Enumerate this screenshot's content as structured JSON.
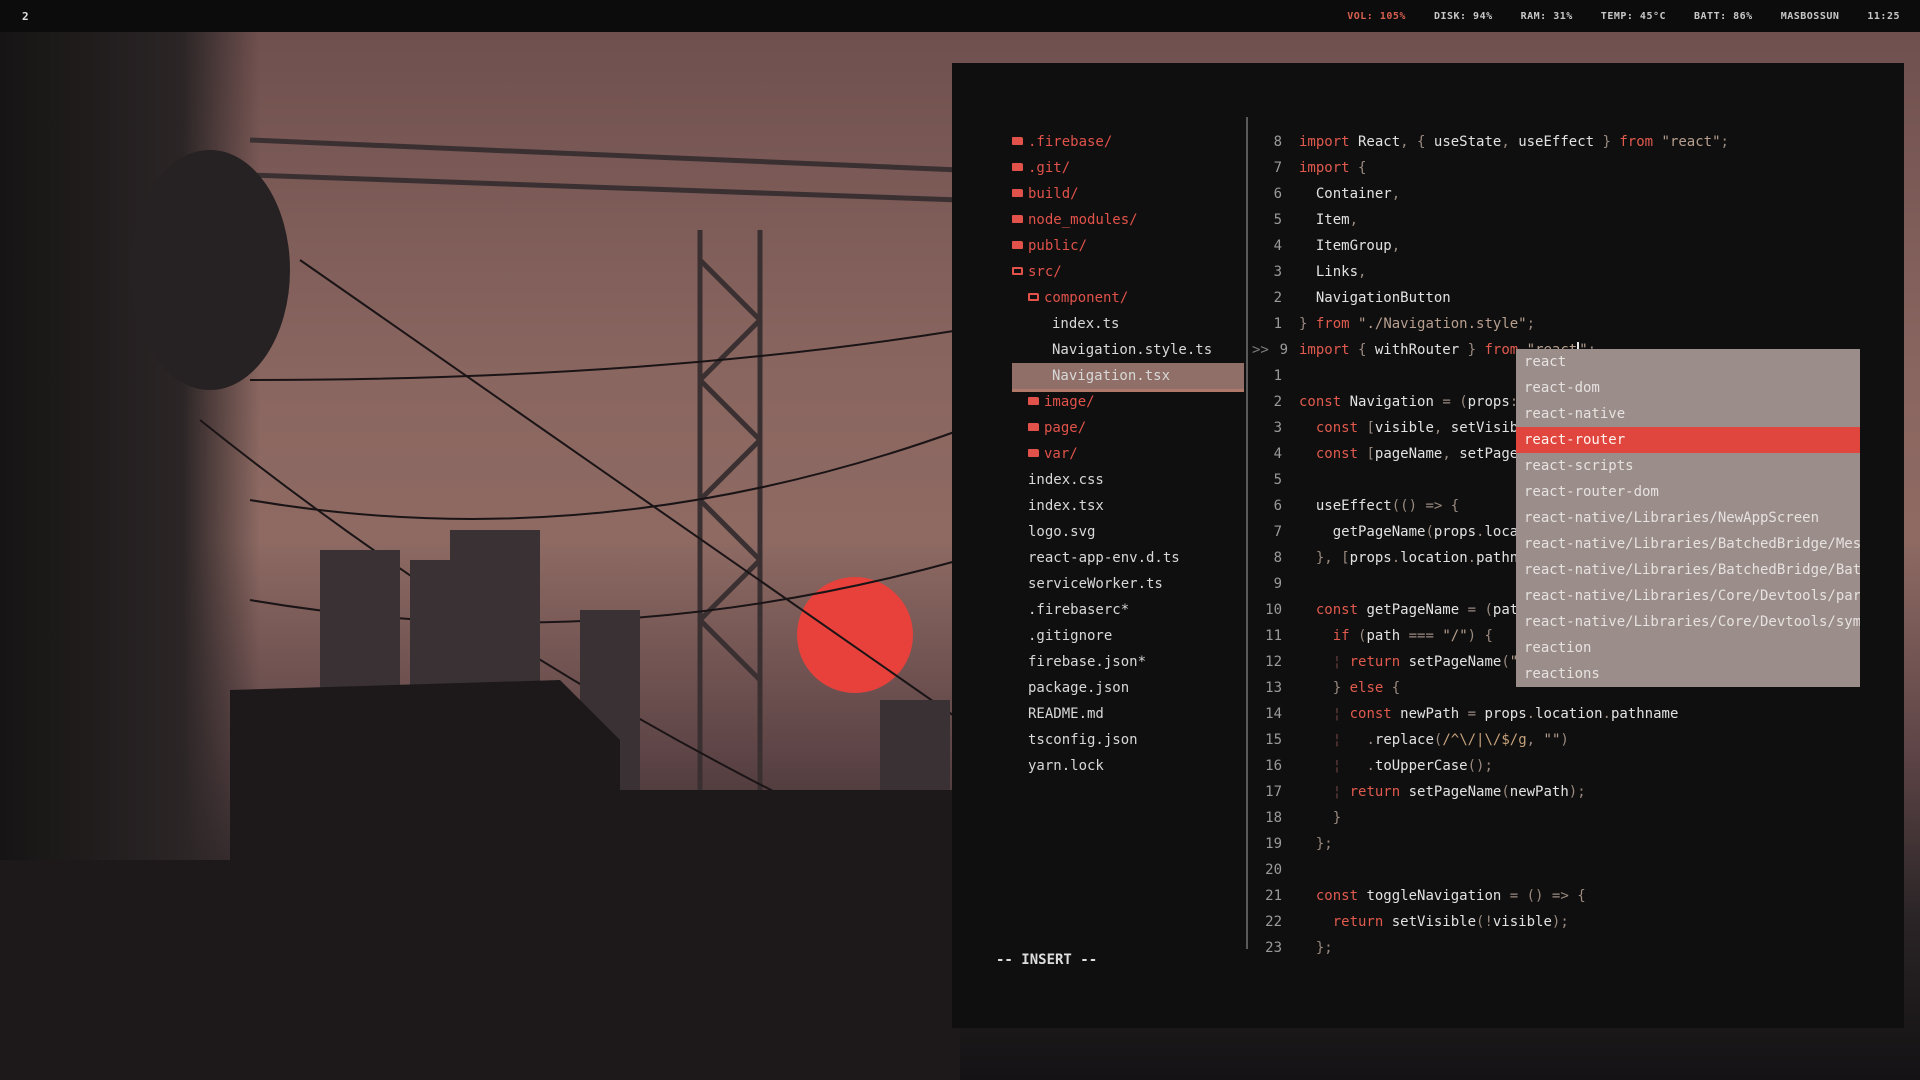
{
  "topbar": {
    "workspace": "2",
    "vol": "VOL: 105%",
    "disk": "DISK: 94%",
    "ram": "RAM: 31%",
    "temp": "TEMP: 45°C",
    "batt": "BATT: 86%",
    "host": "MASBOSSUN",
    "time": "11:25"
  },
  "tree": [
    {
      "label": ".firebase/",
      "type": "dir",
      "indent": 0
    },
    {
      "label": ".git/",
      "type": "dir",
      "indent": 0
    },
    {
      "label": "build/",
      "type": "dir",
      "indent": 0
    },
    {
      "label": "node_modules/",
      "type": "dir",
      "indent": 0
    },
    {
      "label": "public/",
      "type": "dir",
      "indent": 0
    },
    {
      "label": "src/",
      "type": "dir-open",
      "indent": 0
    },
    {
      "label": "component/",
      "type": "dir-open",
      "indent": 1
    },
    {
      "label": "index.ts",
      "type": "file",
      "indent": 2
    },
    {
      "label": "Navigation.style.ts",
      "type": "file",
      "indent": 2
    },
    {
      "label": "Navigation.tsx",
      "type": "file",
      "indent": 2,
      "selected": true
    },
    {
      "label": "image/",
      "type": "dir",
      "indent": 1
    },
    {
      "label": "page/",
      "type": "dir",
      "indent": 1
    },
    {
      "label": "var/",
      "type": "dir",
      "indent": 1
    },
    {
      "label": "index.css",
      "type": "file",
      "indent": 1
    },
    {
      "label": "index.tsx",
      "type": "file",
      "indent": 1
    },
    {
      "label": "logo.svg",
      "type": "file",
      "indent": 1
    },
    {
      "label": "react-app-env.d.ts",
      "type": "file",
      "indent": 1
    },
    {
      "label": "serviceWorker.ts",
      "type": "file",
      "indent": 1
    },
    {
      "label": ".firebaserc*",
      "type": "file",
      "indent": 0
    },
    {
      "label": ".gitignore",
      "type": "file",
      "indent": 0
    },
    {
      "label": "firebase.json*",
      "type": "file",
      "indent": 0
    },
    {
      "label": "package.json",
      "type": "file",
      "indent": 0
    },
    {
      "label": "README.md",
      "type": "file",
      "indent": 0
    },
    {
      "label": "tsconfig.json",
      "type": "file",
      "indent": 0
    },
    {
      "label": "yarn.lock",
      "type": "file",
      "indent": 0
    }
  ],
  "code": [
    {
      "n": "8",
      "html": "<span class=\"kw\">import</span> React<span class=\"punc\">,</span> <span class=\"punc\">{</span> useState<span class=\"punc\">,</span> useEffect <span class=\"punc\">}</span> <span class=\"kw\">from</span> <span class=\"str\">\"react\"</span><span class=\"punc\">;</span>"
    },
    {
      "n": "7",
      "html": "<span class=\"kw\">import</span> <span class=\"punc\">{</span>"
    },
    {
      "n": "6",
      "html": "  Container<span class=\"punc\">,</span>"
    },
    {
      "n": "5",
      "html": "  Item<span class=\"punc\">,</span>"
    },
    {
      "n": "4",
      "html": "  ItemGroup<span class=\"punc\">,</span>"
    },
    {
      "n": "3",
      "html": "  Links<span class=\"punc\">,</span>"
    },
    {
      "n": "2",
      "html": "  NavigationButton"
    },
    {
      "n": "1",
      "html": "<span class=\"punc\">}</span> <span class=\"kw\">from</span> <span class=\"str\">\"./Navigation.style\"</span><span class=\"punc\">;</span>"
    },
    {
      "n": "9",
      "current": true,
      "html": "<span class=\"kw\">import</span> <span class=\"punc\">{</span> withRouter <span class=\"punc\">}</span> <span class=\"kw\">from</span> <span class=\"str ul\">\"react</span><span id=\"cursor\"></span><span class=\"str ul\">\"</span><span class=\"punc\">;</span>"
    },
    {
      "n": "1",
      "html": ""
    },
    {
      "n": "2",
      "html": "<span class=\"kw\">const</span> Navigation <span class=\"punc\">=</span> <span class=\"punc\">(</span>props<span class=\"punc\">:</span>"
    },
    {
      "n": "3",
      "html": "  <span class=\"kw\">const</span> <span class=\"punc\">[</span>visible<span class=\"punc\">,</span> setVisibl"
    },
    {
      "n": "4",
      "html": "  <span class=\"kw\">const</span> <span class=\"punc\">[</span>pageName<span class=\"punc\">,</span> setPageN"
    },
    {
      "n": "5",
      "html": ""
    },
    {
      "n": "6",
      "html": "  useEffect<span class=\"punc\">(()</span> <span class=\"punc\">=&gt;</span> <span class=\"punc\">{</span>"
    },
    {
      "n": "7",
      "html": "    getPageName<span class=\"punc\">(</span>props<span class=\"punc\">.</span>locat"
    },
    {
      "n": "8",
      "html": "  <span class=\"punc\">},</span> <span class=\"punc\">[</span>props<span class=\"punc\">.</span>location<span class=\"punc\">.</span>pathna"
    },
    {
      "n": "9",
      "html": ""
    },
    {
      "n": "10",
      "html": "  <span class=\"kw\">const</span> getPageName <span class=\"punc\">=</span> <span class=\"punc\">(</span>path"
    },
    {
      "n": "11",
      "html": "    <span class=\"kw\">if</span> <span class=\"punc\">(</span>path <span class=\"punc\">===</span> <span class=\"str\">\"/\"</span><span class=\"punc\">)</span> <span class=\"punc\">{</span>"
    },
    {
      "n": "12",
      "html": "    <span class=\"bar\">¦</span> <span class=\"kw\">return</span> setPageName<span class=\"punc\">(</span><span class=\"str\">\"M</span>"
    },
    {
      "n": "13",
      "html": "    <span class=\"punc\">}</span> <span class=\"kw\">else</span> <span class=\"punc\">{</span>"
    },
    {
      "n": "14",
      "html": "    <span class=\"bar\">¦</span> <span class=\"kw\">const</span> newPath <span class=\"punc\">=</span> props<span class=\"punc\">.</span>location<span class=\"punc\">.</span>pathname"
    },
    {
      "n": "15",
      "html": "    <span class=\"bar\">¦</span>   <span class=\"punc\">.</span>replace<span class=\"punc\">(</span><span class=\"rx\">/^\\/|\\/$/g</span><span class=\"punc\">,</span> <span class=\"str\">\"\"</span><span class=\"punc\">)</span>"
    },
    {
      "n": "16",
      "html": "    <span class=\"bar\">¦</span>   <span class=\"punc\">.</span>toUpperCase<span class=\"punc\">();</span>"
    },
    {
      "n": "17",
      "html": "    <span class=\"bar\">¦</span> <span class=\"kw\">return</span> setPageName<span class=\"punc\">(</span>newPath<span class=\"punc\">);</span>"
    },
    {
      "n": "18",
      "html": "    <span class=\"punc\">}</span>"
    },
    {
      "n": "19",
      "html": "  <span class=\"punc\">};</span>"
    },
    {
      "n": "20",
      "html": ""
    },
    {
      "n": "21",
      "html": "  <span class=\"kw\">const</span> toggleNavigation <span class=\"punc\">=</span> <span class=\"punc\">()</span> <span class=\"punc\">=&gt;</span> <span class=\"punc\">{</span>"
    },
    {
      "n": "22",
      "html": "    <span class=\"kw\">return</span> setVisible<span class=\"punc\">(!</span>visible<span class=\"punc\">);</span>"
    },
    {
      "n": "23",
      "html": "  <span class=\"punc\">};</span>"
    }
  ],
  "current_line_marker": ">>",
  "completion": {
    "items": [
      "react",
      "react-dom",
      "react-native",
      "react-router",
      "react-scripts",
      "react-router-dom",
      "react-native/Libraries/NewAppScreen",
      "react-native/Libraries/BatchedBridge/Messa",
      "react-native/Libraries/BatchedBridge/Batch",
      "react-native/Libraries/Core/Devtools/parse",
      "react-native/Libraries/Core/Devtools/symbo",
      "reaction",
      "reactions"
    ],
    "selected_index": 3
  },
  "mode": "-- INSERT --",
  "colors": {
    "accent": "#e0524a",
    "selected_file_bg": "#8f6f67",
    "popup_bg": "#9b8d8a",
    "popup_selected": "#e0463e"
  }
}
